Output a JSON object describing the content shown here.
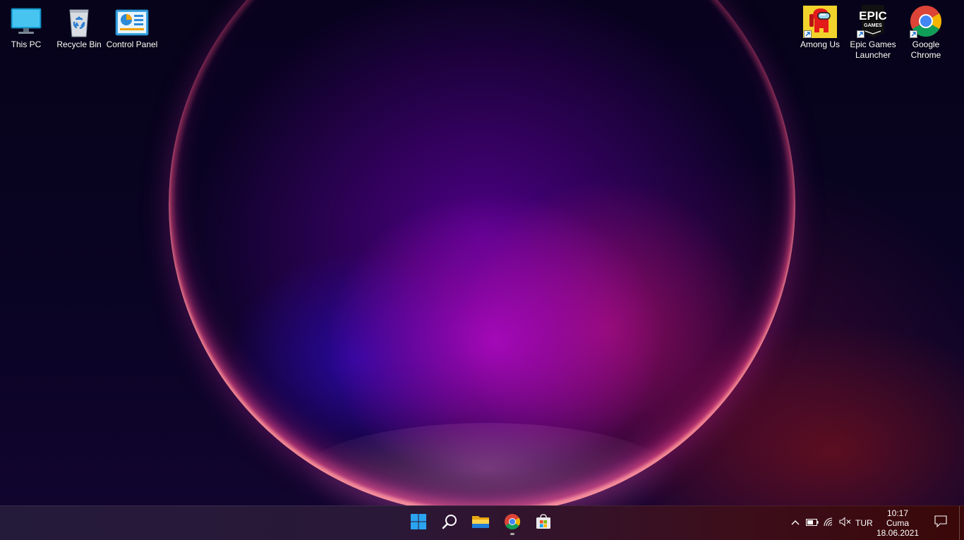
{
  "desktop": {
    "left_icons": [
      {
        "label": "This PC",
        "icon": "monitor-icon"
      },
      {
        "label": "Recycle Bin",
        "icon": "recycle-bin-icon"
      },
      {
        "label": "Control Panel",
        "icon": "control-panel-icon"
      }
    ],
    "right_icons": [
      {
        "label": "Among Us",
        "icon": "among-us-icon"
      },
      {
        "label": "Epic Games Launcher",
        "icon": "epic-games-icon",
        "logo_text": "EPIC",
        "logo_subtext": "GAMES"
      },
      {
        "label": "Google Chrome",
        "icon": "chrome-icon"
      }
    ]
  },
  "taskbar": {
    "pinned": [
      "windows-start-icon",
      "search-icon",
      "file-explorer-icon",
      "chrome-icon",
      "microsoft-store-icon"
    ],
    "tray": {
      "language": "TUR",
      "clock_time": "10:17",
      "clock_day": "Cuma",
      "clock_date": "18.06.2021",
      "icons": [
        "chevron-up-icon",
        "battery-icon",
        "wifi-icon",
        "volume-muted-icon",
        "notification-icon"
      ]
    }
  },
  "colors": {
    "accent": "#0078d4",
    "taskbar_left": "#241a3a",
    "taskbar_right": "#3a0808"
  }
}
